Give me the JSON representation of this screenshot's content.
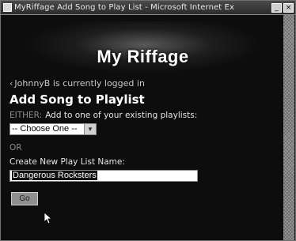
{
  "window": {
    "title": "MyRiffage Add Song to Play List - Microsoft Internet Ex",
    "minimize_icon": "minimize-icon",
    "close_icon": "close-icon"
  },
  "header": {
    "logo_text": "My Riffage"
  },
  "user": {
    "name": "JohnnyB",
    "status_text": "is currently logged in"
  },
  "main": {
    "title": "Add Song to Playlist",
    "either_keyword": "EITHER:",
    "either_text": "Add to one of your existing playlists:",
    "playlist_select": {
      "selected": "-- Choose One --"
    },
    "or_text": "OR",
    "new_label": "Create New Play List Name:",
    "new_name_value": "Dangerous Rocksters",
    "go_label": "Go"
  },
  "colors": {
    "background": "#0d0d0d",
    "text": "#ffffff"
  }
}
